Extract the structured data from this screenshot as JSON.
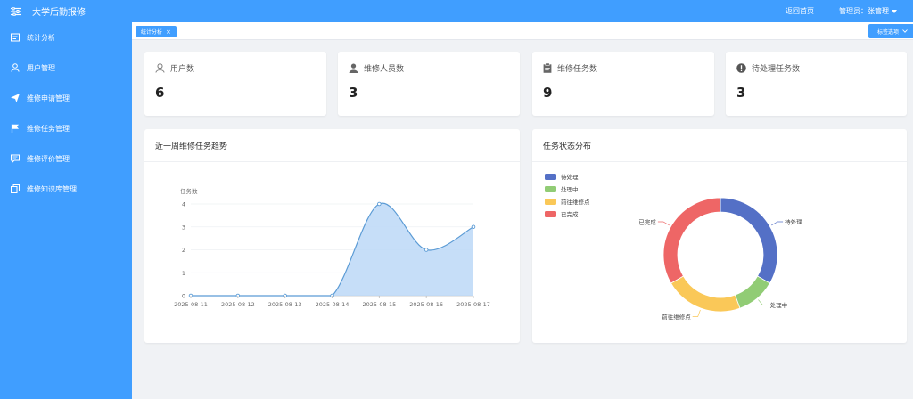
{
  "app": {
    "title": "大学后勤报修"
  },
  "header": {
    "home_link": "返回首页",
    "admin_label": "管理员：张管理"
  },
  "sidebar": {
    "items": [
      {
        "label": "统计分析",
        "icon": "dashboard-icon"
      },
      {
        "label": "用户管理",
        "icon": "user-icon"
      },
      {
        "label": "维修申请管理",
        "icon": "send-icon"
      },
      {
        "label": "维修任务管理",
        "icon": "flag-icon"
      },
      {
        "label": "维修评价管理",
        "icon": "comment-icon"
      },
      {
        "label": "维修知识库管理",
        "icon": "copy-icon"
      }
    ]
  },
  "tabs": {
    "active": "统计分析",
    "close": "×",
    "options_label": "标签选项"
  },
  "stats": [
    {
      "label": "用户数",
      "value": "6",
      "icon": "user-outline-icon"
    },
    {
      "label": "维修人员数",
      "value": "3",
      "icon": "user-solid-icon"
    },
    {
      "label": "维修任务数",
      "value": "9",
      "icon": "clipboard-icon"
    },
    {
      "label": "待处理任务数",
      "value": "3",
      "icon": "warning-icon"
    }
  ],
  "trend": {
    "title": "近一周维修任务趋势",
    "chart_data": {
      "type": "area",
      "title": "",
      "xlabel": "",
      "ylabel": "任务数",
      "x": [
        "2025-08-11",
        "2025-08-12",
        "2025-08-13",
        "2025-08-14",
        "2025-08-15",
        "2025-08-16",
        "2025-08-17"
      ],
      "values": [
        0,
        0,
        0,
        0,
        4,
        2,
        3
      ],
      "yticks": [
        0,
        1,
        2,
        3,
        4
      ],
      "ylim": [
        0,
        4
      ],
      "smooth": true,
      "line_color": "#5b9bd5",
      "fill_color": "#bcd8f7",
      "grid": true
    }
  },
  "status": {
    "title": "任务状态分布",
    "chart_data": {
      "type": "pie",
      "donut": true,
      "legend_position": "top-left",
      "categories": [
        "待处理",
        "处理中",
        "前往维修点",
        "已完成"
      ],
      "values": [
        3,
        1,
        2,
        3
      ],
      "colors": [
        "#5470c6",
        "#91cc75",
        "#fac858",
        "#ee6666"
      ]
    }
  }
}
